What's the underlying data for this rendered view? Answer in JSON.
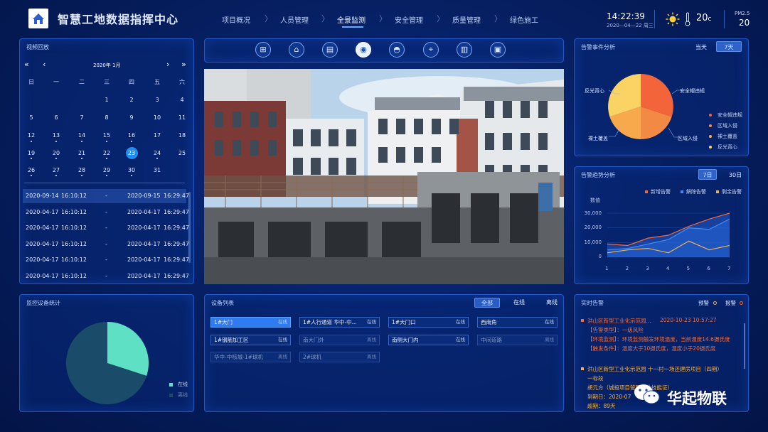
{
  "header": {
    "title": "智慧工地数据指挥中心",
    "nav": [
      "项目概况",
      "人员管理",
      "全景监测",
      "安全管理",
      "质量管理",
      "绿色施工"
    ],
    "active_nav": "全景监测",
    "time": "14:22:39",
    "date": "2020—04—22 周三",
    "temperature": "20",
    "temp_unit": "c",
    "pm_label": "PM2.5",
    "pm_value": "20"
  },
  "video": {
    "title": "视频回放",
    "calendar_month": "2020年 1月",
    "weekdays": [
      "日",
      "一",
      "二",
      "三",
      "四",
      "五",
      "六"
    ],
    "selected_day": "23",
    "records": [
      {
        "start_date": "2020-09-14",
        "start_time": "16:10:12",
        "sep": "-",
        "end_date": "2020-09-15",
        "end_time": "16:29:47"
      },
      {
        "start_date": "2020-04-17",
        "start_time": "16:10:12",
        "sep": "-",
        "end_date": "2020-04-17",
        "end_time": "16:29:47"
      },
      {
        "start_date": "2020-04-17",
        "start_time": "16:10:12",
        "sep": "-",
        "end_date": "2020-04-17",
        "end_time": "16:29:47"
      },
      {
        "start_date": "2020-04-17",
        "start_time": "16:10:12",
        "sep": "-",
        "end_date": "2020-04-17",
        "end_time": "16:29:47"
      },
      {
        "start_date": "2020-04-17",
        "start_time": "16:10:12",
        "sep": "-",
        "end_date": "2020-04-17",
        "end_time": "16:29:47"
      },
      {
        "start_date": "2020-04-17",
        "start_time": "16:10:12",
        "sep": "-",
        "end_date": "2020-04-17",
        "end_time": "16:29:47"
      }
    ]
  },
  "monitor_stats": {
    "title": "监控设备统计",
    "legend": [
      "在线",
      "离线"
    ],
    "colors": [
      "#5ee0c5",
      "#1a4c6a"
    ],
    "online_fraction": 0.3
  },
  "device_list": {
    "title": "设备列表",
    "filters": [
      "全部",
      "在线",
      "离线"
    ],
    "items": [
      {
        "name": "1#大门",
        "status": "在线"
      },
      {
        "name": "1#人行通道 华中-中...",
        "status": "在线"
      },
      {
        "name": "1#大门口",
        "status": "在线"
      },
      {
        "name": "西南角",
        "status": "在线"
      },
      {
        "name": "1#钢筋加工区",
        "status": "在线"
      },
      {
        "name": "南大门外",
        "status": "离线"
      },
      {
        "name": "南侧大门内",
        "status": "在线"
      },
      {
        "name": "中间道路",
        "status": "离线"
      },
      {
        "name": "华中-中核城-1#球机",
        "status": "离线"
      },
      {
        "name": "2#球机",
        "status": "离线"
      }
    ]
  },
  "alarm_events": {
    "title": "告警事件分析",
    "tabs": [
      "当天",
      "7天"
    ],
    "labels": [
      "反光背心",
      "安全帽违规",
      "区域入侵",
      "裸土覆盖"
    ],
    "legend": [
      "安全帽违规",
      "区域入侵",
      "裸土覆盖",
      "反光背心"
    ],
    "colors": [
      "#f3643a",
      "#f38a44",
      "#f7a94c",
      "#fbd364"
    ]
  },
  "alarm_trend": {
    "title": "告警趋势分析",
    "tabs": [
      "7日",
      "30日"
    ],
    "legend": [
      "新增告警",
      "解除告警",
      "剩余告警"
    ],
    "ylabel": "数值",
    "yticks": [
      "30,000",
      "20,000",
      "10,000",
      "0"
    ],
    "xticks": [
      "1",
      "2",
      "3",
      "4",
      "5",
      "6",
      "7"
    ]
  },
  "chart_data": {
    "type": "line",
    "x": [
      1,
      2,
      3,
      4,
      5,
      6,
      7
    ],
    "ylim": [
      0,
      30000
    ],
    "series": [
      {
        "name": "新增告警",
        "values": [
          9000,
          8000,
          13000,
          15000,
          21000,
          26000,
          30000
        ]
      },
      {
        "name": "解除告警",
        "values": [
          5000,
          6000,
          9000,
          12000,
          20000,
          19000,
          26000
        ]
      },
      {
        "name": "剩余告警",
        "values": [
          3000,
          5000,
          6000,
          3000,
          11000,
          5000,
          8000
        ]
      }
    ],
    "series_colors": [
      "#f06a3a",
      "#3f8df5",
      "#f2b24c"
    ]
  },
  "realtime_alarm": {
    "title": "实时告警",
    "tabs": [
      "预警",
      "报警"
    ],
    "alarm1": {
      "location": "洪山区新型工业化示范园...",
      "time": "2020-10-23  10:57:27",
      "line1": "【告警类型】：一级风险",
      "line2": "【环境监测】：环境监测触发环境温度，当前温度14.6摄氏度",
      "line3": "【触发条件】：温度大于10摄氏度，温度小于20摄氏度"
    },
    "alarm2": {
      "location": "洪山区新型工业化示范园 十一村一场还建房项目（四期）",
      "line1": "一标段",
      "line2": "胡元方（城投项目管理专业技能证）",
      "line3": "到期日：2020-07",
      "line4": "超期：89天"
    }
  },
  "watermark": "华起物联"
}
